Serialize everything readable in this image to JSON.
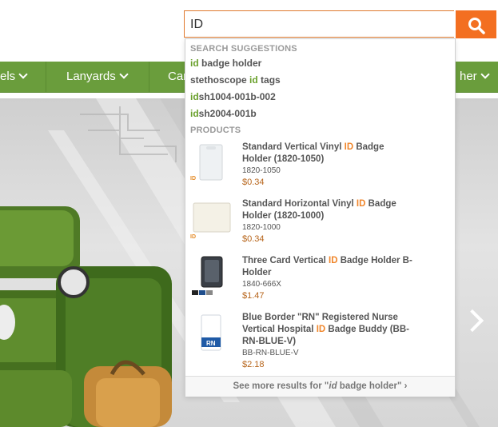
{
  "search": {
    "value": "ID"
  },
  "nav": {
    "items": [
      "els",
      "Lanyards",
      "Car",
      "her"
    ]
  },
  "dropdown": {
    "suggestions_heading": "SEARCH SUGGESTIONS",
    "suggestions": [
      {
        "match": "id",
        "rest": " badge holder"
      },
      {
        "prefix": "stethoscope ",
        "match": "id",
        "rest": " tags"
      },
      {
        "match": "id",
        "rest": "sh1004-001b-002"
      },
      {
        "match": "id",
        "rest": "sh2004-001b"
      }
    ],
    "products_heading": "PRODUCTS",
    "products": [
      {
        "title_a": "Standard Vertical Vinyl ",
        "title_match": "ID",
        "title_b": " Badge Holder (1820-1050)",
        "sku": "1820-1050",
        "price": "$0.34"
      },
      {
        "title_a": "Standard Horizontal Vinyl ",
        "title_match": "ID",
        "title_b": " Badge Holder (1820-1000)",
        "sku": "1820-1000",
        "price": "$0.34"
      },
      {
        "title_a": "Three Card Vertical ",
        "title_match": "ID",
        "title_b": " Badge Holder B-Holder",
        "sku": "1840-666X",
        "price": "$1.47"
      },
      {
        "title_a": "Blue Border \"RN\" Registered Nurse Vertical Hospital ",
        "title_match": "ID",
        "title_b": " Badge Buddy (BB-RN-BLUE-V)",
        "sku": "BB-RN-BLUE-V",
        "price": "$2.18"
      }
    ],
    "see_more_a": "See more results for \"",
    "see_more_match": "id",
    "see_more_b": " badge holder\" ›"
  },
  "thumb_labels": {
    "id": "ID",
    "rn": "RN"
  },
  "colors": {
    "accent": "#f36f21",
    "nav_green": "#6a9d3c",
    "match_green": "#6aa02c",
    "match_orange": "#f0862b"
  }
}
